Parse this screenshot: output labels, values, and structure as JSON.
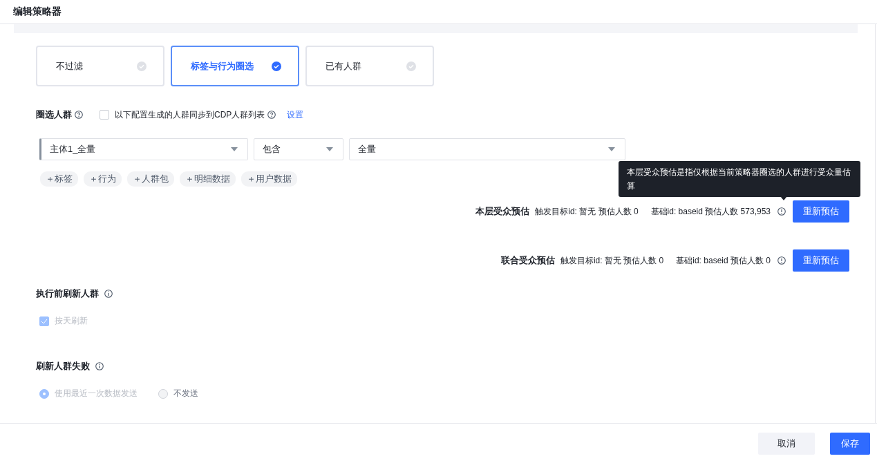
{
  "window": {
    "title": "编辑策略器"
  },
  "strategy_options": [
    {
      "label": "不过滤",
      "selected": false
    },
    {
      "label": "标签与行为圈选",
      "selected": true
    },
    {
      "label": "已有人群",
      "selected": false
    }
  ],
  "crowd": {
    "title": "圈选人群",
    "sync": {
      "label": "以下配置生成的人群同步到CDP人群列表",
      "checked": false
    },
    "settings_link": "设置"
  },
  "condition": {
    "subject": "主体1_全量",
    "operator": "包含",
    "value": "全量"
  },
  "add_buttons": [
    "＋标签",
    "＋行为",
    "＋人群包",
    "＋明细数据",
    "＋用户数据"
  ],
  "tooltip": "本层受众预估是指仅根据当前策略器圈选的人群进行受众量估算",
  "estimates": [
    {
      "title": "本层受众预估",
      "trigger": "触发目标id: 暂无 预估人数 0",
      "base": "基础id: baseid 预估人数 573,953",
      "button": "重新预估"
    },
    {
      "title": "联合受众预估",
      "trigger": "触发目标id: 暂无 预估人数 0",
      "base": "基础id: baseid 预估人数 0",
      "button": "重新预估"
    }
  ],
  "refresh_before": {
    "title": "执行前刷新人群",
    "option": {
      "label": "按天刷新",
      "checked": true,
      "disabled": true
    }
  },
  "refresh_failure": {
    "title": "刷新人群失败",
    "disabled": true,
    "options": [
      {
        "label": "使用最近一次数据发送",
        "selected": true
      },
      {
        "label": "不发送",
        "selected": false
      }
    ]
  },
  "footer": {
    "cancel": "取消",
    "save": "保存"
  }
}
